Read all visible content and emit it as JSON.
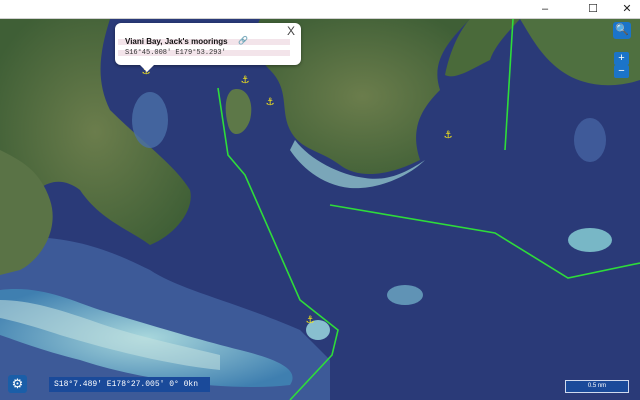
{
  "window": {
    "minimize_glyph": "–",
    "maximize_glyph": "☐",
    "close_glyph": "✕"
  },
  "popup": {
    "title": "Viani Bay, Jack's moorings",
    "link_glyph": "🔗",
    "coords": "S16°45.008' E179°53.293'",
    "close_glyph": "X"
  },
  "controls": {
    "search_glyph": "🔍",
    "zoom_in": "+",
    "zoom_out": "−",
    "settings_glyph": "⚙"
  },
  "status": {
    "position": "S18°7.489' E178°27.005' 0° 0kn"
  },
  "scale": {
    "label": "0.5 nm"
  },
  "colors": {
    "route": "#2edc3a",
    "anchor": "#f5e619",
    "deep_water": "#2a3a78",
    "land": "#4d6b3c",
    "reef": "#6fb0c8"
  },
  "icons": {
    "anchor": "anchor-icon",
    "search": "search-icon",
    "settings": "gear-icon",
    "link": "link-icon"
  }
}
